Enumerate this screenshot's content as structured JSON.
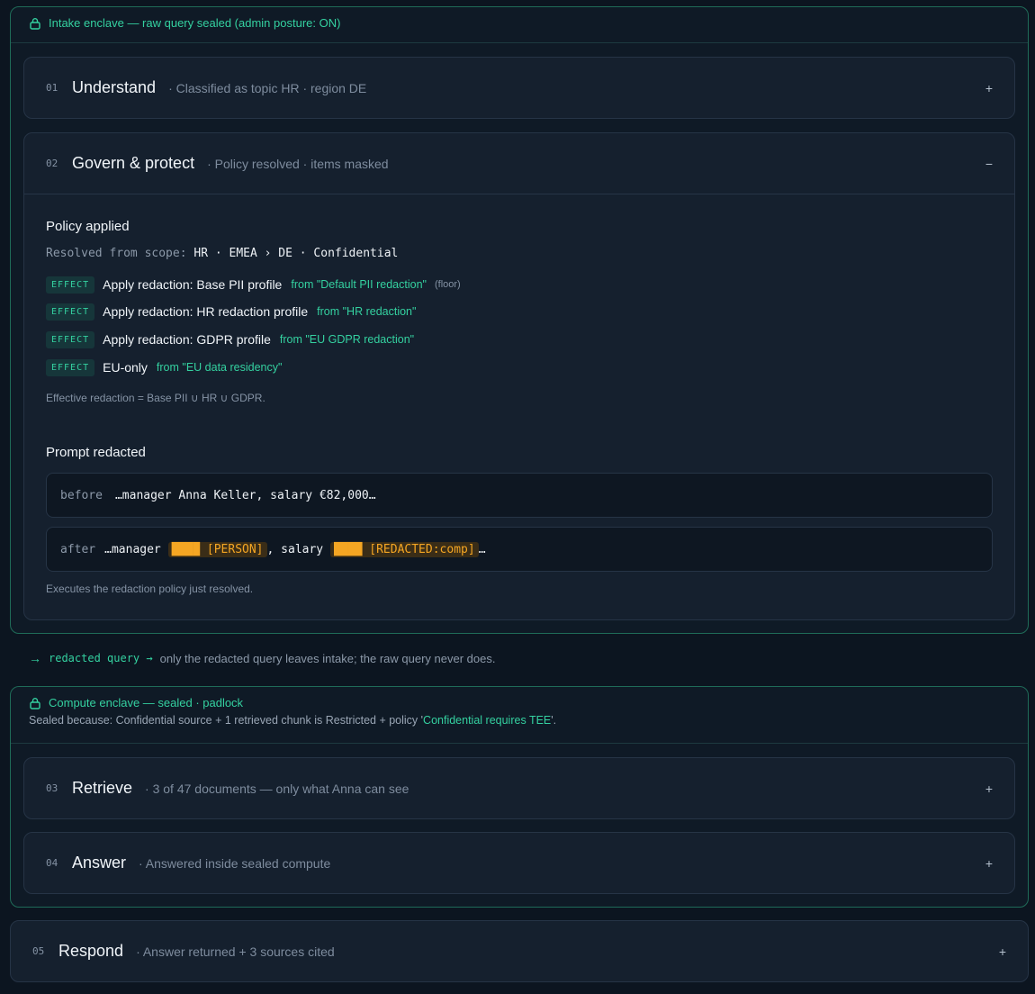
{
  "intake": {
    "header": "Intake enclave — raw query sealed (admin posture: ON)"
  },
  "steps": {
    "s1": {
      "num": "01",
      "title": "Understand",
      "summary": "· Classified as topic HR · region DE",
      "toggle": "+"
    },
    "s2": {
      "num": "02",
      "title": "Govern & protect",
      "summary": "· Policy resolved · items masked",
      "toggle": "−"
    },
    "s3": {
      "num": "03",
      "title": "Retrieve",
      "summary": "· 3 of 47 documents — only what Anna can see",
      "toggle": "+"
    },
    "s4": {
      "num": "04",
      "title": "Answer",
      "summary": "· Answered inside sealed compute",
      "toggle": "+"
    },
    "s5": {
      "num": "05",
      "title": "Respond",
      "summary": "· Answer returned + 3 sources cited",
      "toggle": "+"
    }
  },
  "policy": {
    "title": "Policy applied",
    "scope_label": "Resolved from scope:",
    "scope_value": "HR · EMEA › DE · Confidential",
    "effects": [
      {
        "badge": "EFFECT",
        "text": "Apply redaction: Base PII profile",
        "from": "from \"Default PII redaction\"",
        "extra": "(floor)"
      },
      {
        "badge": "EFFECT",
        "text": "Apply redaction: HR redaction profile",
        "from": "from \"HR redaction\"",
        "extra": ""
      },
      {
        "badge": "EFFECT",
        "text": "Apply redaction: GDPR profile",
        "from": "from \"EU GDPR redaction\"",
        "extra": ""
      },
      {
        "badge": "EFFECT",
        "text": "EU-only",
        "from": "from \"EU data residency\"",
        "extra": ""
      }
    ],
    "effective": "Effective redaction = Base PII ∪ HR ∪ GDPR."
  },
  "prompt": {
    "title": "Prompt redacted",
    "before_label": "before",
    "before_text": "…manager Anna Keller, salary €82,000…",
    "after_label": "after",
    "after_prefix": "…manager",
    "after_person": "████ [PERSON]",
    "after_mid": ", salary",
    "after_comp": "████ [REDACTED:comp]",
    "after_suffix": "…",
    "note": "Executes the redaction policy just resolved."
  },
  "flow": {
    "key": "redacted query →",
    "text": "only the redacted query leaves intake; the raw query never does."
  },
  "compute": {
    "header": "Compute enclave — sealed · padlock",
    "reason_prefix": "Sealed because: Confidential source + 1 retrieved chunk is Restricted + policy '",
    "reason_policy": "Confidential requires TEE",
    "reason_suffix": "'."
  }
}
